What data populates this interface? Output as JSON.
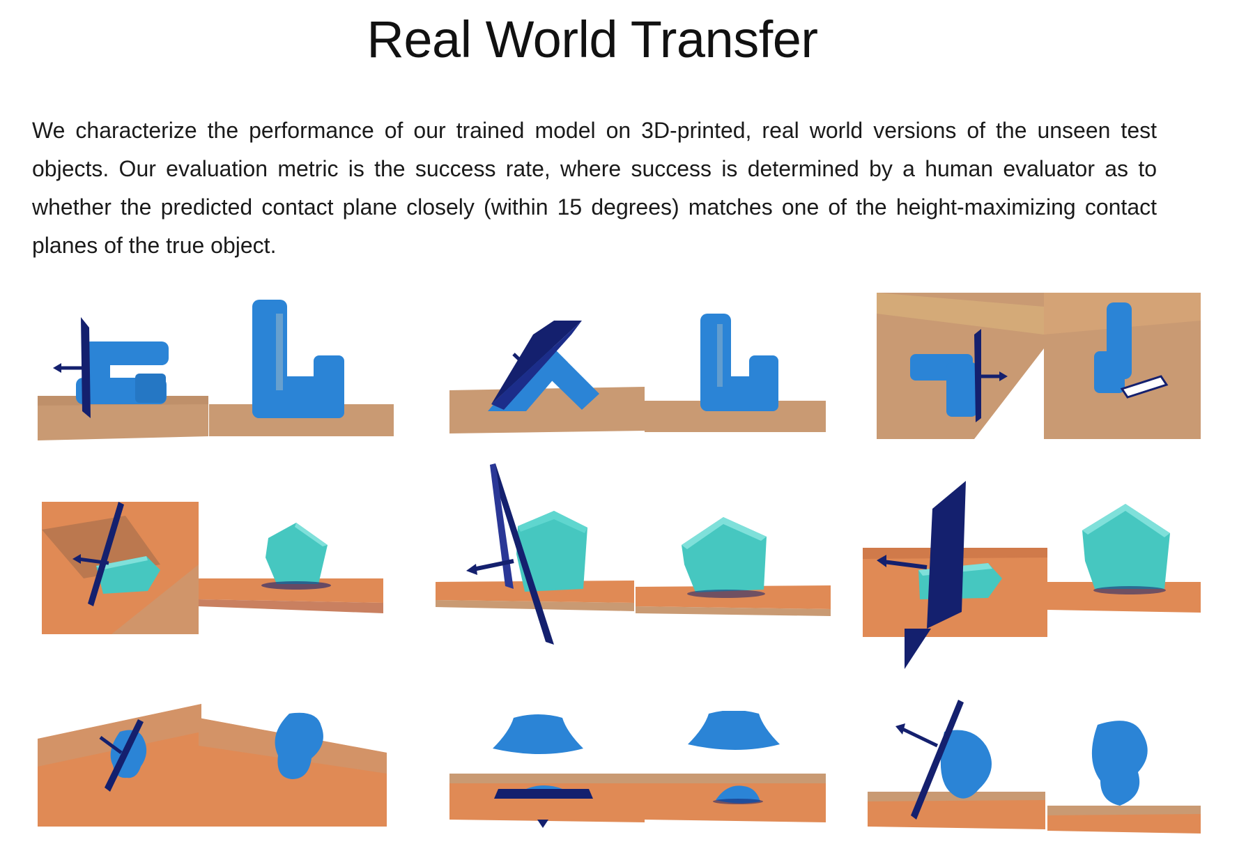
{
  "page": {
    "title": "Real World Transfer",
    "description": "We characterize the performance of our trained model on 3D-printed, real world versions of the unseen test objects. Our evaluation metric is the success rate, where success is determined by a human evaluator as to whether the predicted contact plane closely (within 15 degrees) matches one of the height-maximizing contact planes of the true object."
  },
  "colors": {
    "ground": "#c99a73",
    "ground_warm": "#e08a55",
    "object_blue": "#2b84d6",
    "object_teal": "#46c7c0",
    "plane": "#14206e"
  },
  "figures": [
    {
      "row": 1,
      "col": 1,
      "object": "L-block",
      "views": [
        "prediction",
        "true-object"
      ]
    },
    {
      "row": 1,
      "col": 2,
      "object": "L-block",
      "views": [
        "prediction",
        "true-object"
      ]
    },
    {
      "row": 1,
      "col": 3,
      "object": "L-block",
      "views": [
        "prediction",
        "true-object"
      ]
    },
    {
      "row": 2,
      "col": 1,
      "object": "pentagon",
      "views": [
        "prediction",
        "true-object"
      ]
    },
    {
      "row": 2,
      "col": 2,
      "object": "pentagon",
      "views": [
        "prediction",
        "true-object"
      ]
    },
    {
      "row": 2,
      "col": 3,
      "object": "pentagon",
      "views": [
        "prediction",
        "true-object"
      ]
    },
    {
      "row": 3,
      "col": 1,
      "object": "vase",
      "views": [
        "prediction",
        "true-object"
      ]
    },
    {
      "row": 3,
      "col": 2,
      "object": "vase",
      "views": [
        "prediction",
        "true-object"
      ]
    },
    {
      "row": 3,
      "col": 3,
      "object": "vase",
      "views": [
        "prediction",
        "true-object"
      ]
    }
  ]
}
